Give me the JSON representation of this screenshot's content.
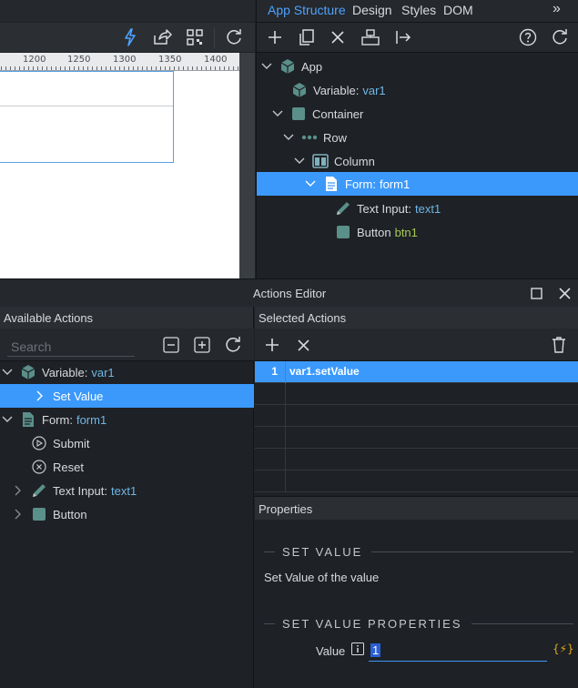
{
  "ruler": {
    "labels": [
      "1200",
      "1250",
      "1300",
      "1350",
      "1400"
    ]
  },
  "tabs": [
    "App Structure",
    "Design",
    "Styles",
    "DOM"
  ],
  "more_tabs": "»",
  "app_tree": [
    {
      "label": "App",
      "sub": "",
      "icon": "cube-icon"
    },
    {
      "label": "Variable:",
      "sub": "var1",
      "icon": "cube-icon"
    },
    {
      "label": "Container",
      "sub": "",
      "icon": "square-icon"
    },
    {
      "label": "Row",
      "sub": "",
      "icon": "dots-icon"
    },
    {
      "label": "Column",
      "sub": "",
      "icon": "column-icon"
    },
    {
      "label": "Form:",
      "sub": "form1",
      "icon": "file-icon"
    },
    {
      "label": "Text Input:",
      "sub": "text1",
      "icon": "pencil-icon"
    },
    {
      "label": "Button",
      "sub": "btn1",
      "icon": "square-icon"
    }
  ],
  "actions_editor": {
    "title": "Actions Editor"
  },
  "available_actions": {
    "title": "Available Actions",
    "search_placeholder": "Search",
    "items": [
      {
        "label": "Variable:",
        "sub": "var1"
      },
      {
        "label": "Set Value",
        "sub": ""
      },
      {
        "label": "Form:",
        "sub": "form1"
      },
      {
        "label": "Submit",
        "sub": ""
      },
      {
        "label": "Reset",
        "sub": ""
      },
      {
        "label": "Text Input:",
        "sub": "text1"
      },
      {
        "label": "Button",
        "sub": ""
      }
    ]
  },
  "selected_actions": {
    "title": "Selected Actions",
    "rows": [
      {
        "num": "1",
        "value": "var1.setValue"
      }
    ]
  },
  "properties": {
    "title": "Properties",
    "section1": "SET VALUE",
    "description": "Set Value of the value",
    "section2": "SET VALUE PROPERTIES",
    "value_label": "Value",
    "value": "1",
    "dynamic_icon": "{⚡}"
  },
  "colors": {
    "accent": "#3b99fc",
    "teal_icon": "#5a8f8a",
    "sub_text": "#6fb7e6",
    "green_sub": "#a7c857"
  }
}
